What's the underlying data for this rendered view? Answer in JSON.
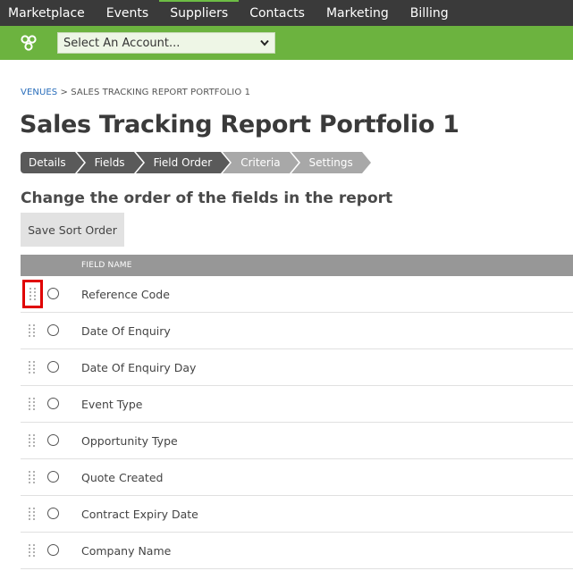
{
  "topnav": {
    "items": [
      "Marketplace",
      "Events",
      "Suppliers",
      "Contacts",
      "Marketing",
      "Billing"
    ],
    "active": "Suppliers"
  },
  "account": {
    "placeholder": "Select An Account..."
  },
  "breadcrumb": {
    "root": "VENUES",
    "separator": ">",
    "current": "SALES TRACKING REPORT PORTFOLIO 1"
  },
  "page_title": "Sales Tracking Report Portfolio 1",
  "steps": [
    {
      "label": "Details",
      "state": "done"
    },
    {
      "label": "Fields",
      "state": "done"
    },
    {
      "label": "Field Order",
      "state": "done"
    },
    {
      "label": "Criteria",
      "state": "todo"
    },
    {
      "label": "Settings",
      "state": "todo"
    }
  ],
  "subheading": "Change the order of the fields in the report",
  "save_button": "Save Sort Order",
  "table": {
    "header": "FIELD NAME",
    "rows": [
      "Reference Code",
      "Date Of Enquiry",
      "Date Of Enquiry Day",
      "Event Type",
      "Opportunity Type",
      "Quote Created",
      "Contract Expiry Date",
      "Company Name"
    ]
  },
  "colors": {
    "nav_bg": "#3a3a3a",
    "accent_green": "#6cb33f",
    "highlight_red": "#e00000"
  }
}
